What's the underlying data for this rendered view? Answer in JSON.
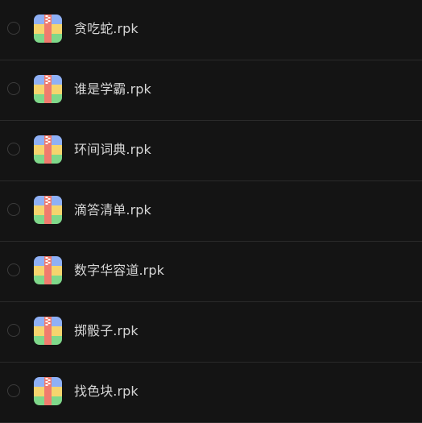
{
  "files": [
    {
      "name": "贪吃蛇.rpk",
      "selected": false,
      "icon": "archive-zip-icon"
    },
    {
      "name": "谁是学霸.rpk",
      "selected": false,
      "icon": "archive-zip-icon"
    },
    {
      "name": "环间词典.rpk",
      "selected": false,
      "icon": "archive-zip-icon"
    },
    {
      "name": "滴答清单.rpk",
      "selected": false,
      "icon": "archive-zip-icon"
    },
    {
      "name": "数字华容道.rpk",
      "selected": false,
      "icon": "archive-zip-icon"
    },
    {
      "name": "掷骰子.rpk",
      "selected": false,
      "icon": "archive-zip-icon"
    },
    {
      "name": "找色块.rpk",
      "selected": false,
      "icon": "archive-zip-icon"
    }
  ],
  "colors": {
    "background": "#141414",
    "divider": "#2a2a2a",
    "text": "#d6d6d6",
    "radio_border": "#3b3b3b",
    "icon_blue": "#8fb0f5",
    "icon_yellow": "#f5d46e",
    "icon_green": "#7fd88a",
    "icon_zipper": "#f07b6e"
  }
}
